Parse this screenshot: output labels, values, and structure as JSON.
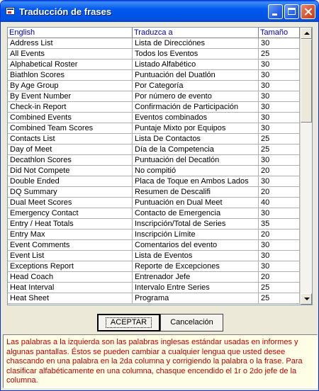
{
  "window": {
    "title": "Traducción de frases"
  },
  "grid": {
    "columns": [
      "English",
      "Traduzca a",
      "Tamaño"
    ],
    "rows": [
      [
        "Address List",
        "Lista de Direcciónes",
        "30"
      ],
      [
        "All Events",
        "Todos los Eventos",
        "25"
      ],
      [
        "Alphabetical Roster",
        "Listado Alfabético",
        "30"
      ],
      [
        "Biathlon Scores",
        "Puntuación del Duatlón",
        "30"
      ],
      [
        "By Age Group",
        "Por Categoría",
        "30"
      ],
      [
        "By Event Number",
        "Por número de evento",
        "30"
      ],
      [
        "Check-in Report",
        "Confirmación de Participación",
        "30"
      ],
      [
        "Combined Events",
        "Eventos combinados",
        "30"
      ],
      [
        "Combined Team Scores",
        "Puntaje Mixto por Equipos",
        "30"
      ],
      [
        "Contacts List",
        "Lista De Contactos",
        "25"
      ],
      [
        "Day of Meet",
        "Día de la Competencia",
        "25"
      ],
      [
        "Decathlon Scores",
        "Puntuación del Decatlón",
        "30"
      ],
      [
        "Did Not Compete",
        "No compitió",
        "20"
      ],
      [
        "Double Ended",
        "Placa de Toque en Ambos Lados",
        "30"
      ],
      [
        "DQ Summary",
        "Resumen de Descalifi",
        "20"
      ],
      [
        "Dual Meet Scores",
        "Puntuación en Dual Meet",
        "40"
      ],
      [
        "Emergency Contact",
        "Contacto de Emergencia",
        "30"
      ],
      [
        "Entry / Heat Totals",
        "Inscripción/Total de Series",
        "35"
      ],
      [
        "Entry Max",
        "Inscripción Límite",
        "20"
      ],
      [
        "Event Comments",
        "Comentarios del evento",
        "30"
      ],
      [
        "Event List",
        "Lista de Eventos",
        "30"
      ],
      [
        "Exceptions Report",
        "Reporte de Excepciones",
        "30"
      ],
      [
        "Head Coach",
        "Entrenador Jefe",
        "20"
      ],
      [
        "Heat Interval",
        "Intervalo Entre Series",
        "25"
      ],
      [
        "Heat Sheet",
        "Programa",
        "25"
      ]
    ]
  },
  "buttons": {
    "ok": "ACEPTAR",
    "cancel": "Cancelación"
  },
  "help_text": "Las palabras a la izquierda son las palabras inglesas estándar usadas en informes y algunas pantallas. Éstos se pueden cambiar a cualquier lengua que usted desee chascando en una palabra en la 2da columna y corrigiendo la palabra o la frase. Para clasificar alfabéticamente en una columna, chasque encendido el 1r o 2do jefe de la columna."
}
